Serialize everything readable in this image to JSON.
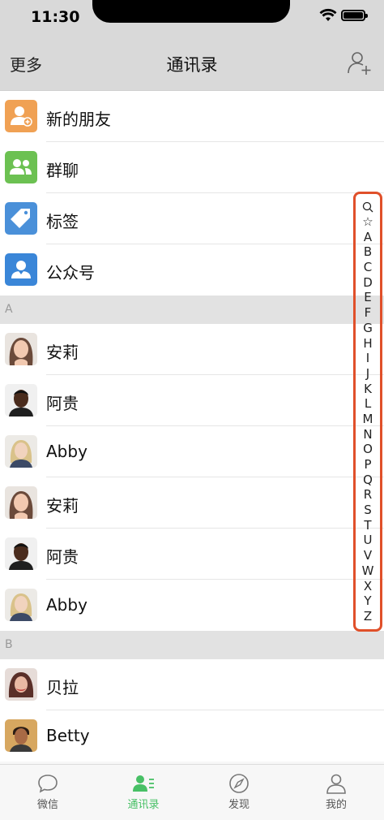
{
  "status": {
    "time": "11:30"
  },
  "nav": {
    "left": "更多",
    "title": "通讯录",
    "right_icon": "add-contact-icon"
  },
  "top_items": [
    {
      "label": "新的朋友",
      "icon": "new-friend-icon",
      "color": "#f0a154"
    },
    {
      "label": "群聊",
      "icon": "group-chat-icon",
      "color": "#6cc152"
    },
    {
      "label": "标签",
      "icon": "tag-icon",
      "color": "#4a90d9"
    },
    {
      "label": "公众号",
      "icon": "official-account-icon",
      "color": "#3a86d8"
    }
  ],
  "sections": [
    {
      "header": "A",
      "contacts": [
        "安莉",
        "阿贵",
        "Abby",
        "安莉",
        "阿贵",
        "Abby"
      ]
    },
    {
      "header": "B",
      "contacts": [
        "贝拉",
        "Betty"
      ]
    }
  ],
  "index": [
    "☆",
    "A",
    "B",
    "C",
    "D",
    "E",
    "F",
    "G",
    "H",
    "I",
    "J",
    "K",
    "L",
    "M",
    "N",
    "O",
    "P",
    "Q",
    "R",
    "S",
    "T",
    "U",
    "V",
    "W",
    "X",
    "Y",
    "Z"
  ],
  "index_highlight_color": "#e0502a",
  "tabs": [
    {
      "label": "微信",
      "icon": "chat-bubble-icon"
    },
    {
      "label": "通讯录",
      "icon": "contacts-icon",
      "active": true
    },
    {
      "label": "发现",
      "icon": "compass-icon"
    },
    {
      "label": "我的",
      "icon": "person-icon"
    }
  ],
  "accent_color": "#48c066"
}
